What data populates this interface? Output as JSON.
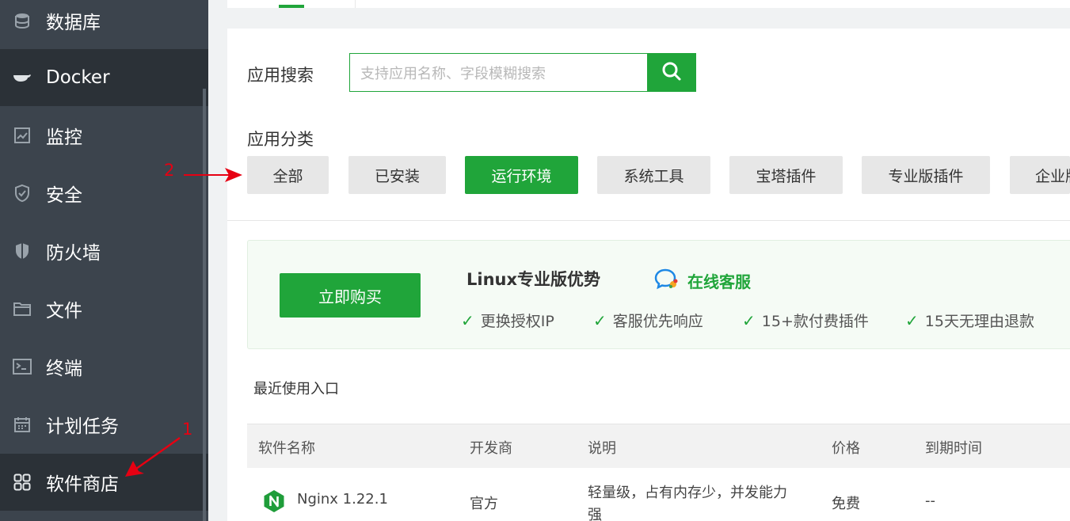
{
  "sidebar": {
    "items": [
      {
        "label": "数据库",
        "icon": "database-icon"
      },
      {
        "label": "Docker",
        "icon": "docker-icon"
      },
      {
        "label": "监控",
        "icon": "monitor-icon"
      },
      {
        "label": "安全",
        "icon": "shield-check-icon"
      },
      {
        "label": "防火墙",
        "icon": "firewall-icon"
      },
      {
        "label": "文件",
        "icon": "folder-icon"
      },
      {
        "label": "终端",
        "icon": "terminal-icon"
      },
      {
        "label": "计划任务",
        "icon": "calendar-icon"
      },
      {
        "label": "软件商店",
        "icon": "app-grid-icon"
      }
    ]
  },
  "search": {
    "label": "应用搜索",
    "placeholder": "支持应用名称、字段模糊搜索"
  },
  "categories": {
    "label": "应用分类",
    "items": [
      "全部",
      "已安装",
      "运行环境",
      "系统工具",
      "宝塔插件",
      "专业版插件",
      "企业版插件"
    ],
    "active": "运行环境"
  },
  "promo": {
    "buy_label": "立即购买",
    "title": "Linux专业版优势",
    "service_label": "在线客服",
    "benefits": [
      "更换授权IP",
      "客服优先响应",
      "15+款付费插件",
      "15天无理由退款"
    ]
  },
  "recent": {
    "label": "最近使用入口"
  },
  "table": {
    "headers": [
      "软件名称",
      "开发商",
      "说明",
      "价格",
      "到期时间"
    ],
    "rows": [
      {
        "name": "Nginx 1.22.1",
        "vendor": "官方",
        "desc_line1": "轻量级，占有内存少，并发能力",
        "desc_line2": "强",
        "price": "免费",
        "expire": "--"
      }
    ]
  },
  "annotations": {
    "marker1": "1",
    "marker2": "2"
  },
  "colors": {
    "accent": "#20a53a",
    "sidebar_bg": "#3c444d",
    "annotation": "#e60012"
  }
}
